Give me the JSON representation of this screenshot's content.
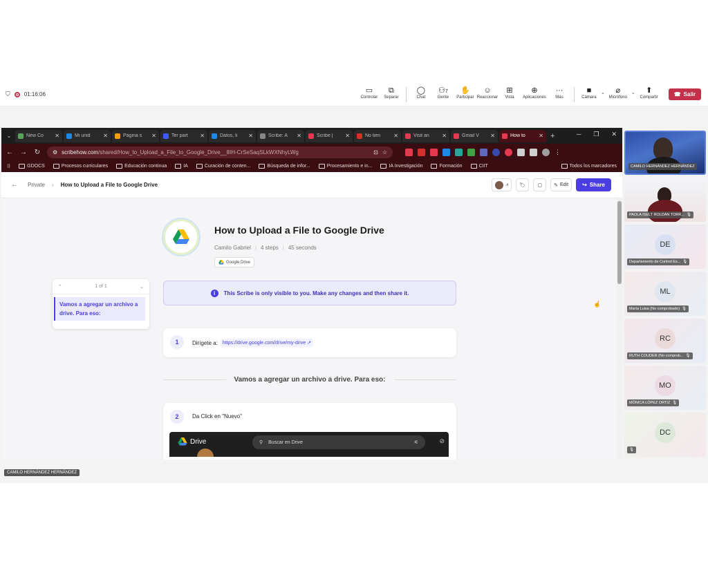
{
  "meeting": {
    "timer": "01:16:06",
    "toolbar": [
      {
        "icon": "screen-icon",
        "label": "Controlar"
      },
      {
        "icon": "popout-icon",
        "label": "Separar"
      },
      {
        "icon": "chat-icon",
        "label": "Chat"
      },
      {
        "icon": "people-icon",
        "label": "Gente",
        "count": "7"
      },
      {
        "icon": "hand-icon",
        "label": "Participar"
      },
      {
        "icon": "emoji-icon",
        "label": "Reaccionar"
      },
      {
        "icon": "grid-icon",
        "label": "Vista"
      },
      {
        "icon": "apps-icon",
        "label": "Aplicaciones"
      },
      {
        "icon": "more-icon",
        "label": "Más"
      }
    ],
    "camera_label": "Cámara",
    "mic_label": "Micrófono",
    "share_label": "Compartir",
    "leave_label": "Salir",
    "presenter_name": "CAMILO HERNÁNDEZ HERNÁNDEZ",
    "colors": {
      "leave": "#c4314b"
    }
  },
  "browser": {
    "tabs": [
      {
        "title": "New Co",
        "color": "#5aa35a"
      },
      {
        "title": "Mi unid",
        "color": "#1e88e5"
      },
      {
        "title": "Página s",
        "color": "#f39c12"
      },
      {
        "title": "Ter part",
        "color": "#3d5afe"
      },
      {
        "title": "Datos, li",
        "color": "#1e88e5"
      },
      {
        "title": "Scribe: A",
        "color": "#888888"
      },
      {
        "title": "Scribe |",
        "color": "#e53950"
      },
      {
        "title": "No tien",
        "color": "#d93025"
      },
      {
        "title": "Visit an",
        "color": "#e53950"
      },
      {
        "title": "Gmail V",
        "color": "#e53950"
      },
      {
        "title": "How to",
        "color": "#e53950",
        "active": true
      }
    ],
    "url_host": "scribehow.com",
    "url_path": "/shared/How_to_Upload_a_File_to_Google_Drive__8IH-CrSeSaqSLkWXNhyLWg",
    "bookmarks": [
      "GDOCS",
      "Procesos curriculares",
      "Educación continua",
      "IA",
      "Curación de conten...",
      "Búsqueda de infor...",
      "Procesamiento e in...",
      "IA Investigación",
      "Formación",
      "CIIT"
    ],
    "bookmarks_all": "Todos los marcadores"
  },
  "page": {
    "breadcrumb_private": "Private",
    "breadcrumb_title": "How to Upload a File to Google Drive",
    "edit_label": "Edit",
    "share_label": "Share",
    "title": "How to Upload a File to Google Drive",
    "author": "Camilo Gabriel",
    "steps_count": "4 steps",
    "duration": "45 seconds",
    "tag": "Google Drive",
    "toc_counter": "1 of 1",
    "toc_item": "Vamos a agregar un archivo a drive. Para eso:",
    "notice": "This Scribe is only visible to you. Make any changes and then share it.",
    "step1_num": "1",
    "step1_text": "Dirígete a:",
    "step1_link": "https://drive.google.com/drive/my-drive",
    "section_heading": "Vamos a agregar un archivo a drive. Para eso:",
    "step2_num": "2",
    "step2_text": "Da Click en \"Nuevo\"",
    "drive_brand": "Drive",
    "drive_search": "Buscar en Drive",
    "colors": {
      "accent": "#4b3ee0"
    }
  },
  "participants": [
    {
      "name": "CAMILO HERNÁNDEZ HERNÁNDEZ",
      "type": "video"
    },
    {
      "name": "PAOLA ISELT ROLDÁN TORR...",
      "type": "video"
    },
    {
      "name": "Departamento de Control Es...",
      "initials": "DE"
    },
    {
      "name": "María Luisa (No comprobado)",
      "initials": "ML"
    },
    {
      "name": "RUTH COUDER (No comprob...",
      "initials": "RC"
    },
    {
      "name": "MÓNICA LÓPEZ ORTIZ",
      "initials": "MO"
    },
    {
      "name": "",
      "initials": "DC"
    }
  ]
}
